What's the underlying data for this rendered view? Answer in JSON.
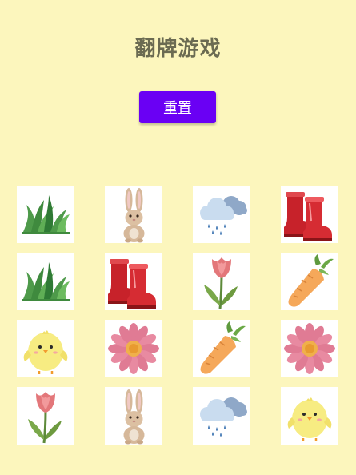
{
  "title": "翻牌游戏",
  "reset_label": "重置",
  "cards": [
    "grass",
    "rabbit",
    "rain-cloud",
    "boots",
    "grass",
    "boots",
    "tulip",
    "carrot",
    "chick",
    "flower",
    "carrot",
    "flower",
    "tulip",
    "rabbit",
    "rain-cloud",
    "chick"
  ]
}
